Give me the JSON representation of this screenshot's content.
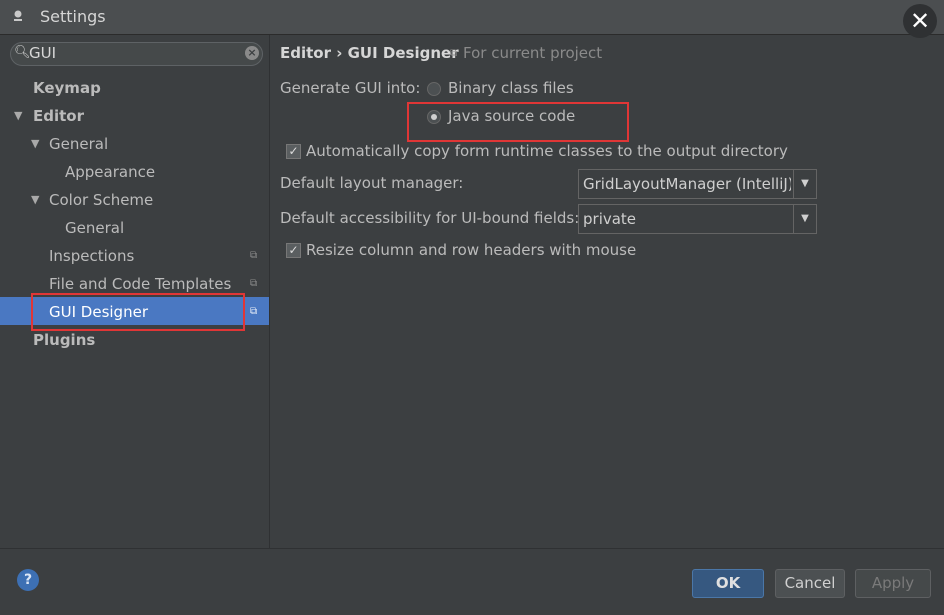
{
  "window": {
    "title": "Settings",
    "close_glyph": "✕"
  },
  "search": {
    "value": "GUI",
    "placeholder": ""
  },
  "tree": {
    "keymap": "Keymap",
    "editor": "Editor",
    "general": "General",
    "appearance": "Appearance",
    "color_scheme": "Color Scheme",
    "color_scheme_general": "General",
    "inspections": "Inspections",
    "file_templates": "File and Code Templates",
    "gui_designer": "GUI Designer",
    "plugins": "Plugins"
  },
  "breadcrumb": {
    "path": "Editor › GUI Designer",
    "scope": "For current project"
  },
  "form": {
    "generate_label": "Generate GUI into:",
    "radio_binary": "Binary class files",
    "radio_java": "Java source code",
    "copy_runtime": "Automatically copy form runtime classes to the output directory",
    "layout_manager_label": "Default layout manager:",
    "layout_manager_value": "GridLayoutManager (IntelliJ)",
    "accessibility_label": "Default accessibility for UI-bound fields:",
    "accessibility_value": "private",
    "resize_headers": "Resize column and row headers with mouse"
  },
  "buttons": {
    "help": "?",
    "ok": "OK",
    "cancel": "Cancel",
    "apply": "Apply"
  },
  "colors": {
    "background": "#3c3f41",
    "selection": "#4a78c2",
    "highlight": "#e03636",
    "ok_button": "#365880"
  },
  "icons": [
    "app-icon",
    "search-icon",
    "clear-icon",
    "close-icon",
    "project-scope-icon",
    "help-icon",
    "chevron-down-icon"
  ]
}
